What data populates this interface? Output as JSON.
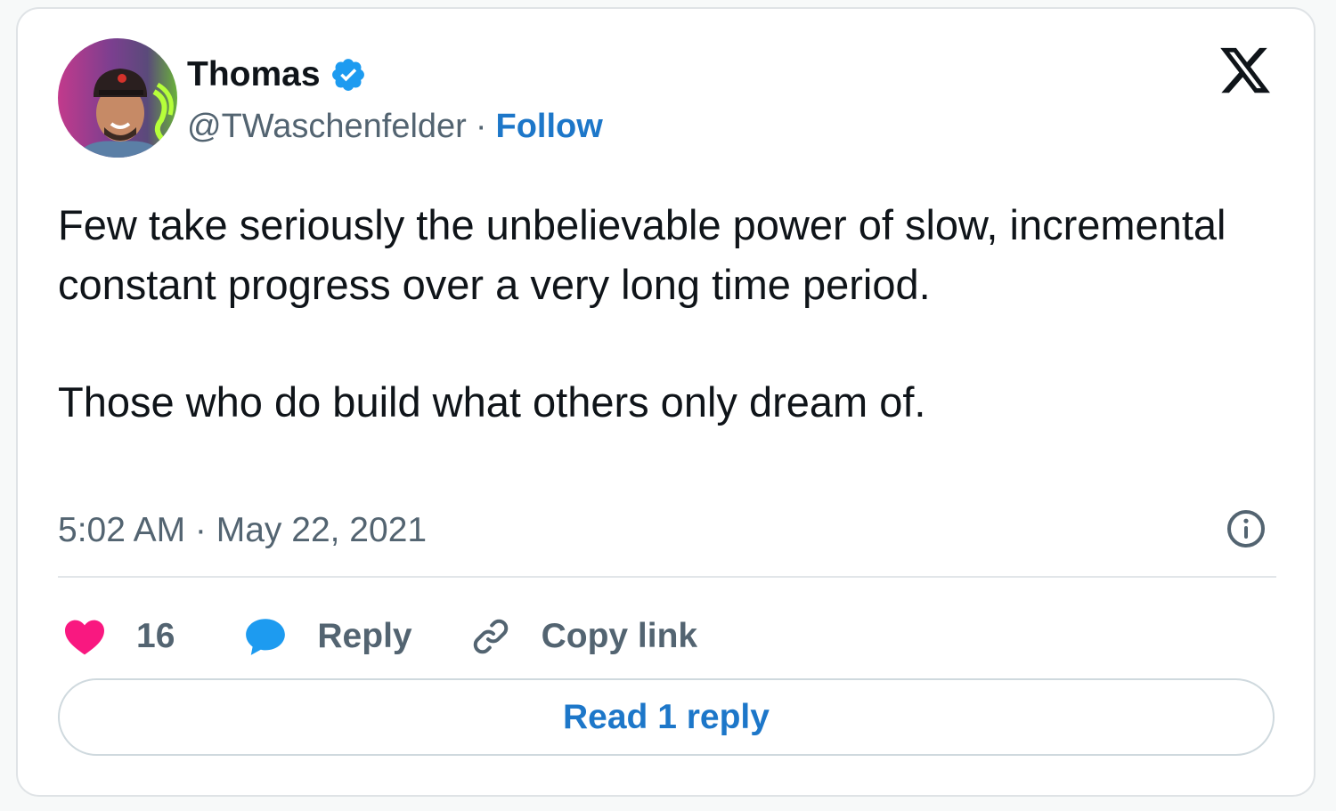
{
  "author": {
    "name": "Thomas",
    "handle": "@TWaschenfelder",
    "separator": "·",
    "follow_label": "Follow",
    "verified": true
  },
  "tweet": {
    "paragraphs": [
      "Few take seriously the unbelievable power of slow, incremental constant progress over a very long time period.",
      "Those who do build what others only dream of."
    ],
    "timestamp": "5:02 AM · May 22, 2021"
  },
  "actions": {
    "like_count": "16",
    "reply_label": "Reply",
    "copy_link_label": "Copy link"
  },
  "read_replies_label": "Read 1 reply",
  "icons": {
    "verified": "verified-badge-icon",
    "platform": "x-logo-icon",
    "info": "info-icon",
    "like": "heart-icon",
    "reply": "speech-bubble-icon",
    "copy": "link-icon"
  },
  "colors": {
    "accent": "#1d77c9",
    "verified": "#1d9bf0",
    "like": "#f91880",
    "text": "#0f1419",
    "secondary": "#536471"
  }
}
